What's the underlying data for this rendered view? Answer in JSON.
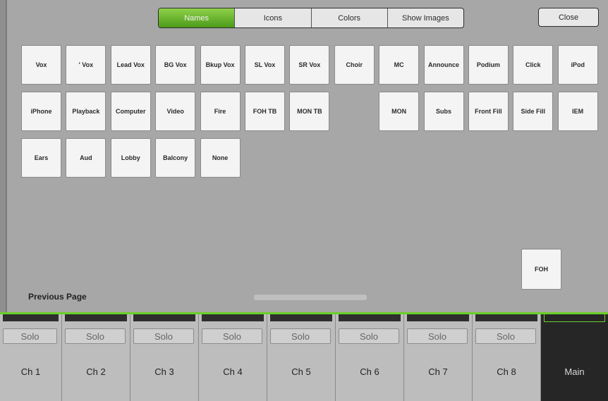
{
  "tabs": [
    {
      "label": "Names",
      "active": true
    },
    {
      "label": "Icons",
      "active": false
    },
    {
      "label": "Colors",
      "active": false
    },
    {
      "label": "Show Images",
      "active": false
    }
  ],
  "close_label": "Close",
  "names_row1": [
    "Vox",
    "' Vox",
    "Lead Vox",
    "BG Vox",
    "Bkup Vox",
    "SL Vox",
    "SR Vox",
    "Choir",
    "MC",
    "Announce",
    "Podium",
    "Click",
    "iPod"
  ],
  "names_row2": [
    "iPhone",
    "Playback",
    "Computer",
    "Video",
    "Fire",
    "FOH TB",
    "MON TB",
    "",
    "MON",
    "Subs",
    "Front Fill",
    "Side Fill",
    "IEM"
  ],
  "names_row3": [
    "Ears",
    "Aud",
    "Lobby",
    "Balcony",
    "None"
  ],
  "foh_label": "FOH",
  "previous_page": "Previous Page",
  "channels": [
    {
      "solo": "Solo",
      "label": "Ch 1"
    },
    {
      "solo": "Solo",
      "label": "Ch 2"
    },
    {
      "solo": "Solo",
      "label": "Ch 3"
    },
    {
      "solo": "Solo",
      "label": "Ch 4"
    },
    {
      "solo": "Solo",
      "label": "Ch 5"
    },
    {
      "solo": "Solo",
      "label": "Ch 6"
    },
    {
      "solo": "Solo",
      "label": "Ch 7"
    },
    {
      "solo": "Solo",
      "label": "Ch 8"
    }
  ],
  "main_label": "Main",
  "colors": {
    "accent": "#6ccf2a",
    "active_tab": "#5aa820"
  }
}
